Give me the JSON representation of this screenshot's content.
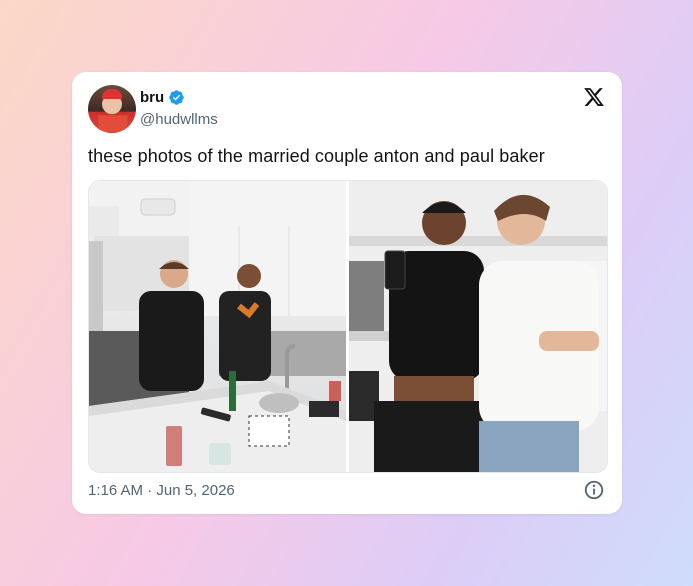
{
  "tweet": {
    "display_name": "bru",
    "handle": "@hudwllms",
    "text": "these photos of the married couple anton and paul baker",
    "timestamp": "1:16 AM · Jun 5, 2026",
    "verified": true
  },
  "icons": {
    "verified": "verified-badge-icon",
    "platform": "x-logo-icon",
    "info": "info-icon"
  },
  "media": {
    "count": 2
  },
  "colors": {
    "card_bg": "#ffffff",
    "text_primary": "#0f1419",
    "text_secondary": "#536471",
    "verified_blue": "#1d9bf0"
  }
}
